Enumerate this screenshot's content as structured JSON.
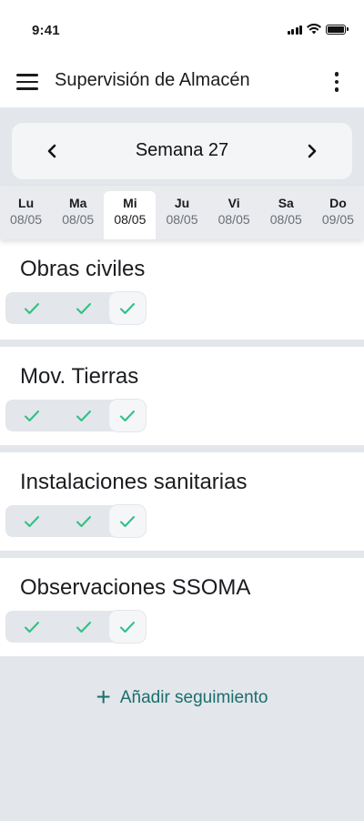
{
  "status_bar": {
    "time": "9:41"
  },
  "appbar": {
    "title": "Supervisión de Almacén",
    "menu_icon": "hamburger-menu-icon",
    "more_icon": "more-vertical-icon"
  },
  "week": {
    "label": "Semana 27",
    "prev_glyph": "‹",
    "next_glyph": "›"
  },
  "days": [
    {
      "name": "Lu",
      "date": "08/05"
    },
    {
      "name": "Ma",
      "date": "08/05"
    },
    {
      "name": "Mi",
      "date": "08/05",
      "active": true
    },
    {
      "name": "Ju",
      "date": "08/05"
    },
    {
      "name": "Vi",
      "date": "08/05"
    },
    {
      "name": "Sa",
      "date": "08/05"
    },
    {
      "name": "Do",
      "date": "09/05"
    }
  ],
  "sections": [
    {
      "name": "Obras civiles",
      "checks": 3
    },
    {
      "name": "Mov. Tierras",
      "checks": 3
    },
    {
      "name": "Instalaciones sanitarias",
      "checks": 3
    },
    {
      "name": "Observaciones SSOMA",
      "checks": 3
    }
  ],
  "add_button": {
    "label": "Añadir seguimiento",
    "icon": "plus-icon"
  },
  "colors": {
    "accent": "#1a6e6e",
    "check": "#2fbf85",
    "background": "#e3e6ea"
  }
}
